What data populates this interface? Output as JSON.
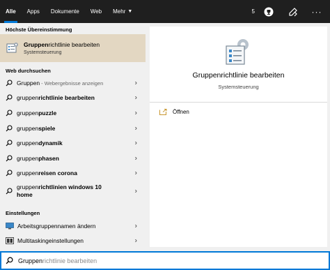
{
  "tabs": [
    {
      "label": "Alle",
      "active": true
    },
    {
      "label": "Apps"
    },
    {
      "label": "Dokumente"
    },
    {
      "label": "Web"
    },
    {
      "label": "Mehr"
    }
  ],
  "points": "5",
  "best_match": {
    "heading": "Höchste Übereinstimmung",
    "title_bold": "Gruppen",
    "title_rest": "richtlinie bearbeiten",
    "subtitle": "Systemsteuerung"
  },
  "web": {
    "heading": "Web durchsuchen",
    "items": [
      {
        "prefix": "Gruppen",
        "bold": "",
        "hint": " - Webergebnisse anzeigen"
      },
      {
        "prefix": "gruppen",
        "bold": "richtlinie bearbeiten",
        "hint": ""
      },
      {
        "prefix": "gruppen",
        "bold": "puzzle",
        "hint": ""
      },
      {
        "prefix": "gruppen",
        "bold": "spiele",
        "hint": ""
      },
      {
        "prefix": "gruppen",
        "bold": "dynamik",
        "hint": ""
      },
      {
        "prefix": "gruppen",
        "bold": "phasen",
        "hint": ""
      },
      {
        "prefix": "gruppen",
        "bold": "reisen corona",
        "hint": ""
      },
      {
        "prefix": "gruppen",
        "bold": "richtlinien windows 10",
        "bold2": "home",
        "hint": ""
      }
    ]
  },
  "settings": {
    "heading": "Einstellungen",
    "items": [
      {
        "label": "Arbeitsgruppennamen ändern"
      },
      {
        "label": "Multitaskingeinstellungen"
      }
    ]
  },
  "preview": {
    "title": "Gruppenrichtlinie bearbeiten",
    "subtitle": "Systemsteuerung",
    "action": "Öffnen"
  },
  "search": {
    "typed": "Gruppen",
    "completion": "richtlinie bearbeiten"
  },
  "colors": {
    "accent": "#0078d7",
    "highlight": "#e3d7c2",
    "topbar": "#1f1f1f"
  }
}
